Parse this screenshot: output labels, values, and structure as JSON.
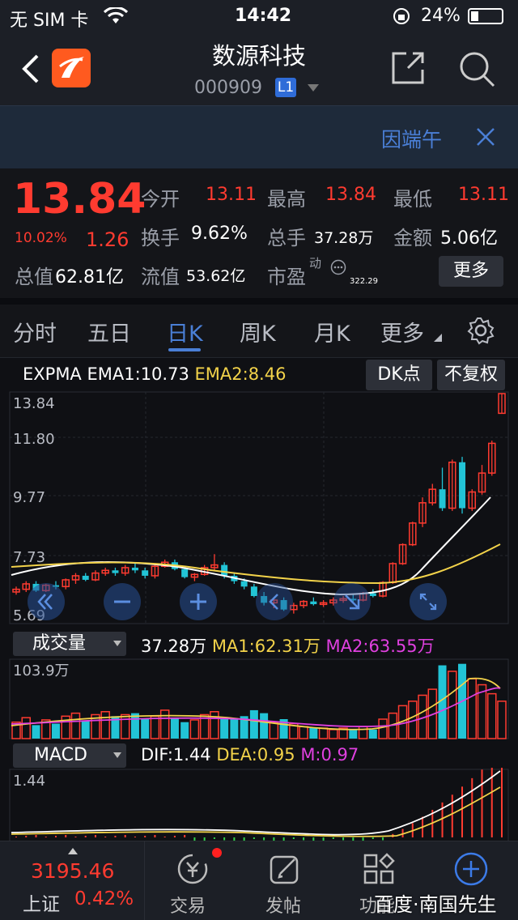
{
  "status": {
    "carrier": "无 SIM 卡",
    "time": "14:42",
    "battery": "24%"
  },
  "header": {
    "name": "数源科技",
    "code": "000909",
    "level": "L1"
  },
  "banner": {
    "text": "因端午"
  },
  "quote": {
    "price": "13.84",
    "pct": "10.02%",
    "chg": "1.26",
    "open_label": "今开",
    "open": "13.11",
    "high_label": "最高",
    "high": "13.84",
    "low_label": "最低",
    "low": "13.11",
    "turnover_label": "换手",
    "turnover": "9.62%",
    "volume_label": "总手",
    "volume": "37.28万",
    "amount_label": "金额",
    "amount": "5.06亿",
    "total_value_label": "总值",
    "total_value": "62.81亿",
    "float_value_label": "流值",
    "float_value": "53.62亿",
    "pe_label": "市盈",
    "pe_sup": "动",
    "pe_value": "322.29",
    "more_label": "更多"
  },
  "tabs": [
    {
      "label": "分时"
    },
    {
      "label": "五日"
    },
    {
      "label": "日K"
    },
    {
      "label": "周K"
    },
    {
      "label": "月K"
    },
    {
      "label": "更多"
    }
  ],
  "kline": {
    "indicator": "EXPMA",
    "ema1": "EMA1:10.73",
    "ema2": "EMA2:8.46",
    "dk_button": "DK点",
    "adjust_button": "不复权",
    "y_labels": [
      "13.84",
      "11.80",
      "9.77",
      "7.73",
      "5.69"
    ]
  },
  "volume": {
    "selector": "成交量",
    "value": "37.28万",
    "ma1": "MA1:62.31万",
    "ma2": "MA2:63.55万",
    "max_label": "103.9万"
  },
  "macd": {
    "selector": "MACD",
    "dif": "DIF:1.44",
    "dea": "DEA:0.95",
    "m": "M:0.97",
    "max_label": "1.44"
  },
  "bottom": {
    "index_value": "3195.46",
    "index_name": "上证",
    "index_pct": "0.42%",
    "trade": "交易",
    "post": "发帖",
    "function": "功能",
    "watermark": "百度·南国先生"
  },
  "colors": {
    "up": "#ff3b30",
    "down": "#22c4d6",
    "ema1": "#ffffff",
    "ema2": "#f3d34a",
    "accent": "#4a7fd6",
    "ma2": "#e040e0",
    "macd_neg": "#2ed24a"
  },
  "chart_data": {
    "type": "candlestick",
    "ylim": [
      5.69,
      13.84
    ],
    "candles": [
      [
        6.5,
        6.7,
        6.4,
        6.6
      ],
      [
        6.6,
        6.9,
        6.5,
        6.8
      ],
      [
        6.8,
        6.9,
        6.5,
        6.55
      ],
      [
        6.55,
        6.8,
        6.5,
        6.75
      ],
      [
        6.75,
        6.9,
        6.6,
        6.7
      ],
      [
        6.7,
        7.0,
        6.6,
        6.95
      ],
      [
        6.95,
        7.2,
        6.8,
        7.1
      ],
      [
        7.1,
        7.2,
        6.9,
        6.95
      ],
      [
        6.95,
        7.3,
        6.9,
        7.2
      ],
      [
        7.2,
        7.4,
        7.1,
        7.3
      ],
      [
        7.3,
        7.4,
        7.1,
        7.2
      ],
      [
        7.2,
        7.5,
        7.1,
        7.4
      ],
      [
        7.4,
        7.6,
        7.2,
        7.3
      ],
      [
        7.3,
        7.4,
        7.0,
        7.1
      ],
      [
        7.1,
        7.5,
        7.0,
        7.45
      ],
      [
        7.45,
        7.7,
        7.4,
        7.6
      ],
      [
        7.6,
        7.7,
        7.3,
        7.35
      ],
      [
        7.35,
        7.4,
        7.0,
        7.05
      ],
      [
        7.05,
        7.2,
        6.9,
        7.15
      ],
      [
        7.15,
        7.5,
        7.1,
        7.4
      ],
      [
        7.4,
        7.9,
        7.3,
        7.5
      ],
      [
        7.5,
        7.6,
        7.0,
        7.1
      ],
      [
        7.1,
        7.2,
        6.8,
        6.9
      ],
      [
        6.9,
        7.0,
        6.6,
        6.7
      ],
      [
        6.7,
        6.8,
        6.3,
        6.35
      ],
      [
        6.35,
        6.5,
        6.0,
        6.1
      ],
      [
        6.1,
        6.3,
        5.9,
        6.2
      ],
      [
        6.2,
        6.3,
        5.8,
        5.85
      ],
      [
        5.85,
        6.1,
        5.7,
        6.0
      ],
      [
        6.0,
        6.2,
        5.9,
        6.15
      ],
      [
        6.15,
        6.3,
        6.0,
        6.05
      ],
      [
        6.05,
        6.2,
        5.95,
        6.1
      ],
      [
        6.1,
        6.3,
        6.0,
        6.2
      ],
      [
        6.2,
        6.35,
        6.1,
        6.25
      ],
      [
        6.25,
        6.4,
        6.1,
        6.2
      ],
      [
        6.2,
        6.5,
        6.15,
        6.45
      ],
      [
        6.45,
        6.6,
        6.3,
        6.35
      ],
      [
        6.35,
        6.9,
        6.3,
        6.85
      ],
      [
        6.85,
        7.6,
        6.8,
        7.55
      ],
      [
        7.55,
        8.3,
        7.5,
        8.25
      ],
      [
        8.25,
        9.1,
        8.2,
        9.05
      ],
      [
        9.05,
        10.0,
        8.9,
        9.8
      ],
      [
        9.8,
        10.5,
        9.7,
        10.3
      ],
      [
        10.3,
        11.1,
        9.5,
        9.6
      ],
      [
        9.6,
        11.4,
        9.5,
        11.3
      ],
      [
        11.3,
        11.5,
        9.4,
        9.6
      ],
      [
        9.6,
        10.3,
        9.5,
        10.2
      ],
      [
        10.2,
        11.2,
        10.1,
        10.9
      ],
      [
        10.9,
        12.1,
        10.8,
        12.0
      ],
      [
        13.11,
        13.84,
        13.11,
        13.84
      ]
    ],
    "volumes": [
      [
        22,
        1
      ],
      [
        28,
        1
      ],
      [
        18,
        0
      ],
      [
        25,
        1
      ],
      [
        20,
        0
      ],
      [
        30,
        1
      ],
      [
        34,
        1
      ],
      [
        24,
        0
      ],
      [
        32,
        1
      ],
      [
        36,
        1
      ],
      [
        30,
        0
      ],
      [
        32,
        1
      ],
      [
        34,
        0
      ],
      [
        26,
        0
      ],
      [
        30,
        1
      ],
      [
        38,
        1
      ],
      [
        28,
        0
      ],
      [
        22,
        0
      ],
      [
        25,
        1
      ],
      [
        32,
        1
      ],
      [
        36,
        1
      ],
      [
        28,
        0
      ],
      [
        26,
        0
      ],
      [
        30,
        0
      ],
      [
        38,
        0
      ],
      [
        34,
        0
      ],
      [
        22,
        1
      ],
      [
        26,
        0
      ],
      [
        20,
        1
      ],
      [
        16,
        1
      ],
      [
        15,
        0
      ],
      [
        14,
        1
      ],
      [
        12,
        1
      ],
      [
        14,
        1
      ],
      [
        12,
        0
      ],
      [
        16,
        1
      ],
      [
        12,
        0
      ],
      [
        26,
        1
      ],
      [
        34,
        1
      ],
      [
        44,
        1
      ],
      [
        50,
        1
      ],
      [
        58,
        1
      ],
      [
        66,
        1
      ],
      [
        98,
        0
      ],
      [
        90,
        1
      ],
      [
        100,
        0
      ],
      [
        80,
        1
      ],
      [
        72,
        1
      ],
      [
        60,
        1
      ],
      [
        50,
        1
      ]
    ]
  }
}
